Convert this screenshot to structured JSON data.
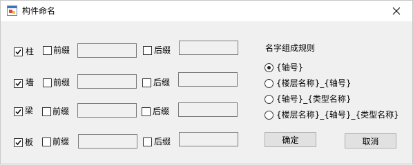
{
  "window": {
    "title": "构件命名"
  },
  "rows": [
    {
      "enabled_label": "柱",
      "enabled": true,
      "prefix_label": "前缀",
      "prefix_checked": false,
      "prefix_value": "",
      "suffix_label": "后缀",
      "suffix_checked": false,
      "suffix_value": ""
    },
    {
      "enabled_label": "墙",
      "enabled": true,
      "prefix_label": "前缀",
      "prefix_checked": false,
      "prefix_value": "",
      "suffix_label": "后缀",
      "suffix_checked": false,
      "suffix_value": ""
    },
    {
      "enabled_label": "梁",
      "enabled": true,
      "prefix_label": "前缀",
      "prefix_checked": false,
      "prefix_value": "",
      "suffix_label": "后缀",
      "suffix_checked": false,
      "suffix_value": ""
    },
    {
      "enabled_label": "板",
      "enabled": true,
      "prefix_label": "前缀",
      "prefix_checked": false,
      "prefix_value": "",
      "suffix_label": "后缀",
      "suffix_checked": false,
      "suffix_value": ""
    }
  ],
  "naming_rule": {
    "title": "名字组成规则",
    "options": [
      {
        "label": "{轴号}",
        "selected": true
      },
      {
        "label": "{楼层名称}_{轴号}",
        "selected": false
      },
      {
        "label": "{轴号}_{类型名称}",
        "selected": false
      },
      {
        "label": "{楼层名称}_{轴号}_{类型名称}",
        "selected": false
      }
    ]
  },
  "buttons": {
    "ok_label": "确定",
    "cancel_label": "取消"
  }
}
